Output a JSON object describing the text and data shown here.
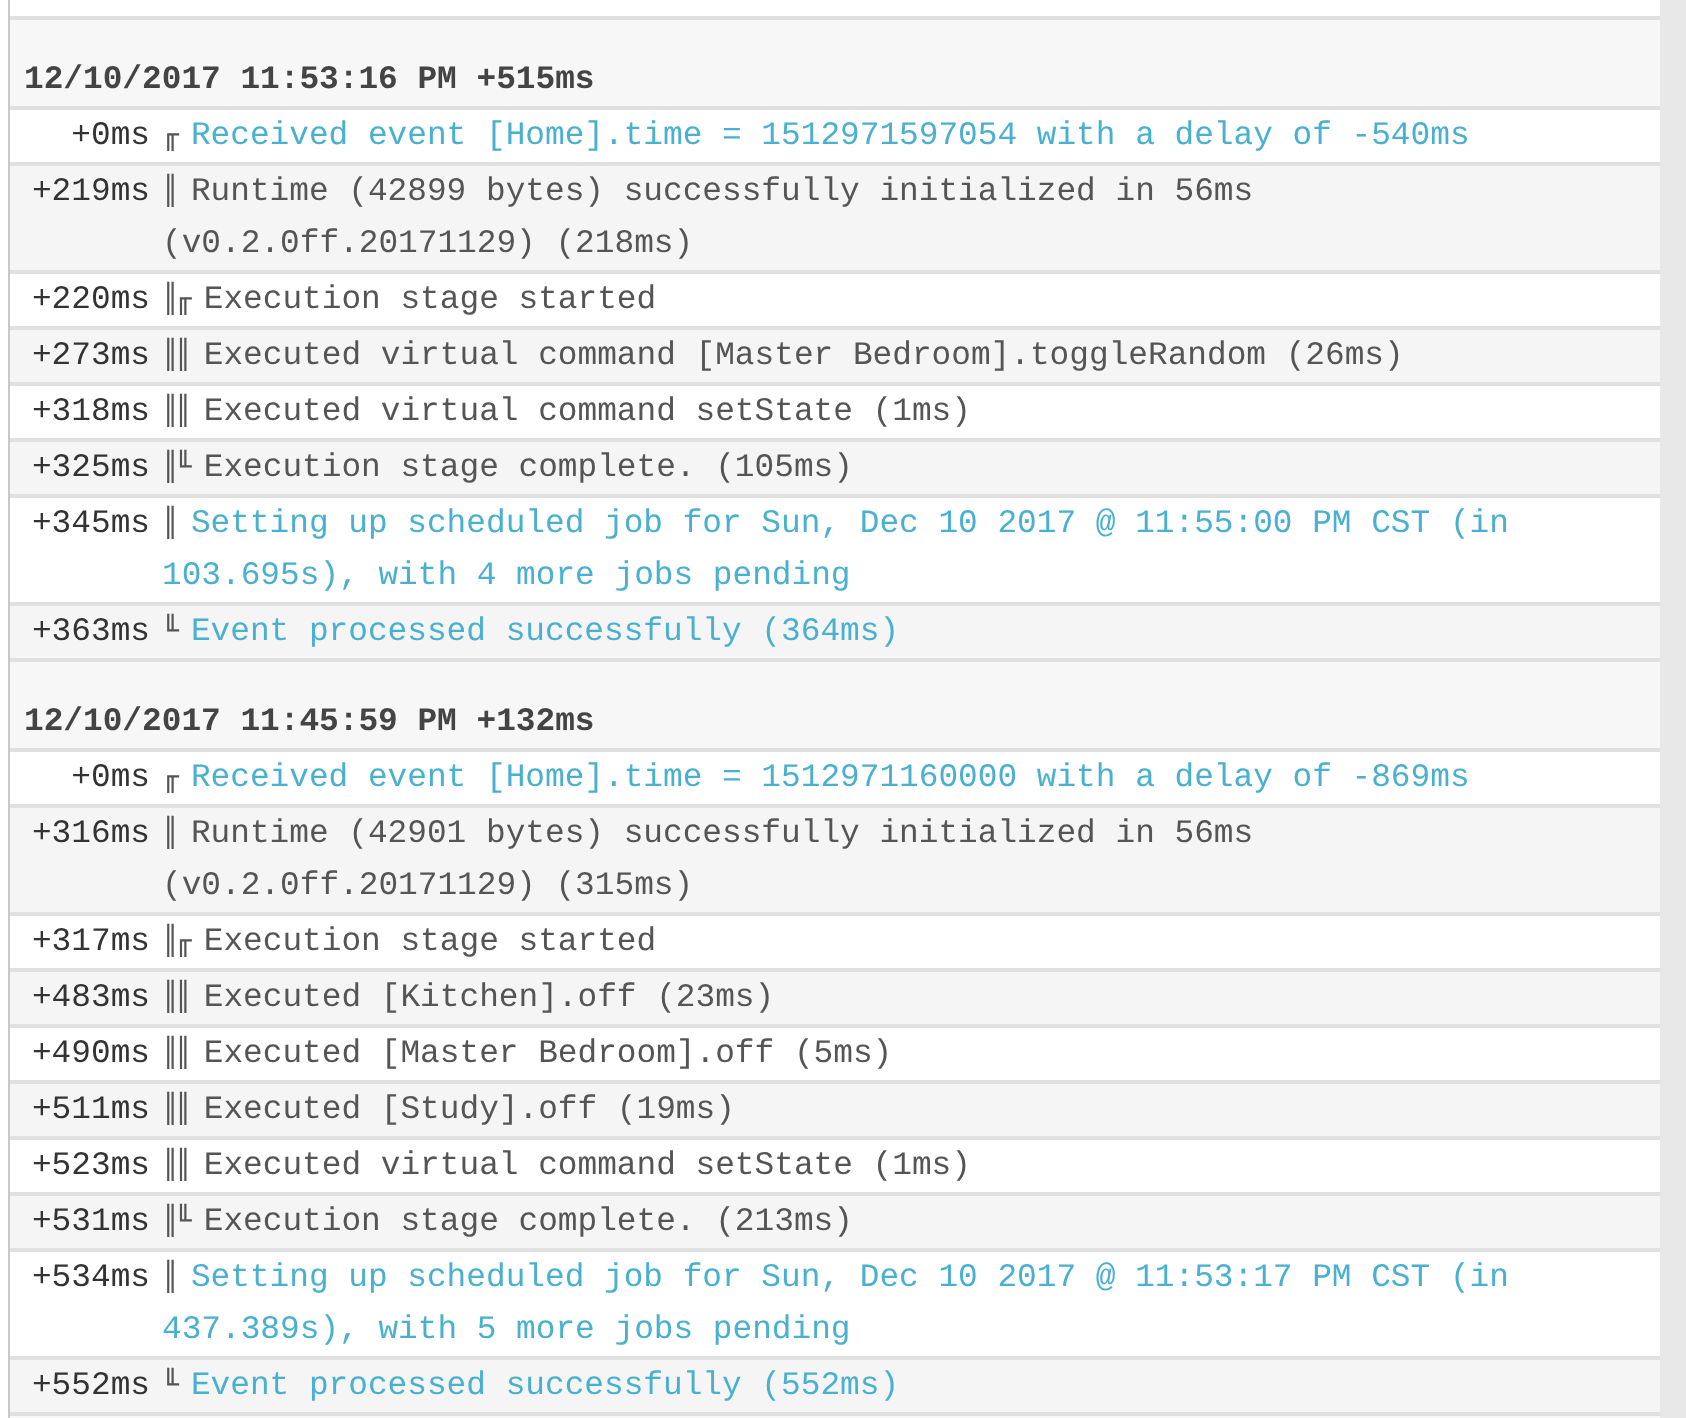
{
  "sections": [
    {
      "timestamp": "12/10/2017 11:53:16 PM +515ms",
      "entries": [
        {
          "time": "+0ms",
          "prefix": "╓",
          "text": "Received event [Home].time = 1512971597054 with a delay of -540ms",
          "kind": "event"
        },
        {
          "time": "+219ms",
          "prefix": "║",
          "text": "Runtime (42899 bytes) successfully initialized in 56ms (v0.2.0ff.20171129) (218ms)",
          "kind": "plain"
        },
        {
          "time": "+220ms",
          "prefix": "║╓",
          "text": "Execution stage started",
          "kind": "plain"
        },
        {
          "time": "+273ms",
          "prefix": "║║",
          "text": "Executed virtual command [Master Bedroom].toggleRandom (26ms)",
          "kind": "plain"
        },
        {
          "time": "+318ms",
          "prefix": "║║",
          "text": "Executed virtual command setState (1ms)",
          "kind": "plain"
        },
        {
          "time": "+325ms",
          "prefix": "║╙",
          "text": "Execution stage complete. (105ms)",
          "kind": "plain"
        },
        {
          "time": "+345ms",
          "prefix": "║",
          "text": "Setting up scheduled job for Sun, Dec 10 2017 @ 11:55:00 PM CST (in 103.695s), with 4 more jobs pending",
          "kind": "event"
        },
        {
          "time": "+363ms",
          "prefix": "╙",
          "text": "Event processed successfully (364ms)",
          "kind": "event"
        }
      ]
    },
    {
      "timestamp": "12/10/2017 11:45:59 PM +132ms",
      "entries": [
        {
          "time": "+0ms",
          "prefix": "╓",
          "text": "Received event [Home].time = 1512971160000 with a delay of -869ms",
          "kind": "event"
        },
        {
          "time": "+316ms",
          "prefix": "║",
          "text": "Runtime (42901 bytes) successfully initialized in 56ms (v0.2.0ff.20171129) (315ms)",
          "kind": "plain"
        },
        {
          "time": "+317ms",
          "prefix": "║╓",
          "text": "Execution stage started",
          "kind": "plain"
        },
        {
          "time": "+483ms",
          "prefix": "║║",
          "text": "Executed [Kitchen].off (23ms)",
          "kind": "plain"
        },
        {
          "time": "+490ms",
          "prefix": "║║",
          "text": "Executed [Master Bedroom].off (5ms)",
          "kind": "plain"
        },
        {
          "time": "+511ms",
          "prefix": "║║",
          "text": "Executed [Study].off (19ms)",
          "kind": "plain"
        },
        {
          "time": "+523ms",
          "prefix": "║║",
          "text": "Executed virtual command setState (1ms)",
          "kind": "plain"
        },
        {
          "time": "+531ms",
          "prefix": "║╙",
          "text": "Execution stage complete. (213ms)",
          "kind": "plain"
        },
        {
          "time": "+534ms",
          "prefix": "║",
          "text": "Setting up scheduled job for Sun, Dec 10 2017 @ 11:53:17 PM CST (in 437.389s), with 5 more jobs pending",
          "kind": "event"
        },
        {
          "time": "+552ms",
          "prefix": "╙",
          "text": "Event processed successfully (552ms)",
          "kind": "event"
        }
      ]
    }
  ]
}
